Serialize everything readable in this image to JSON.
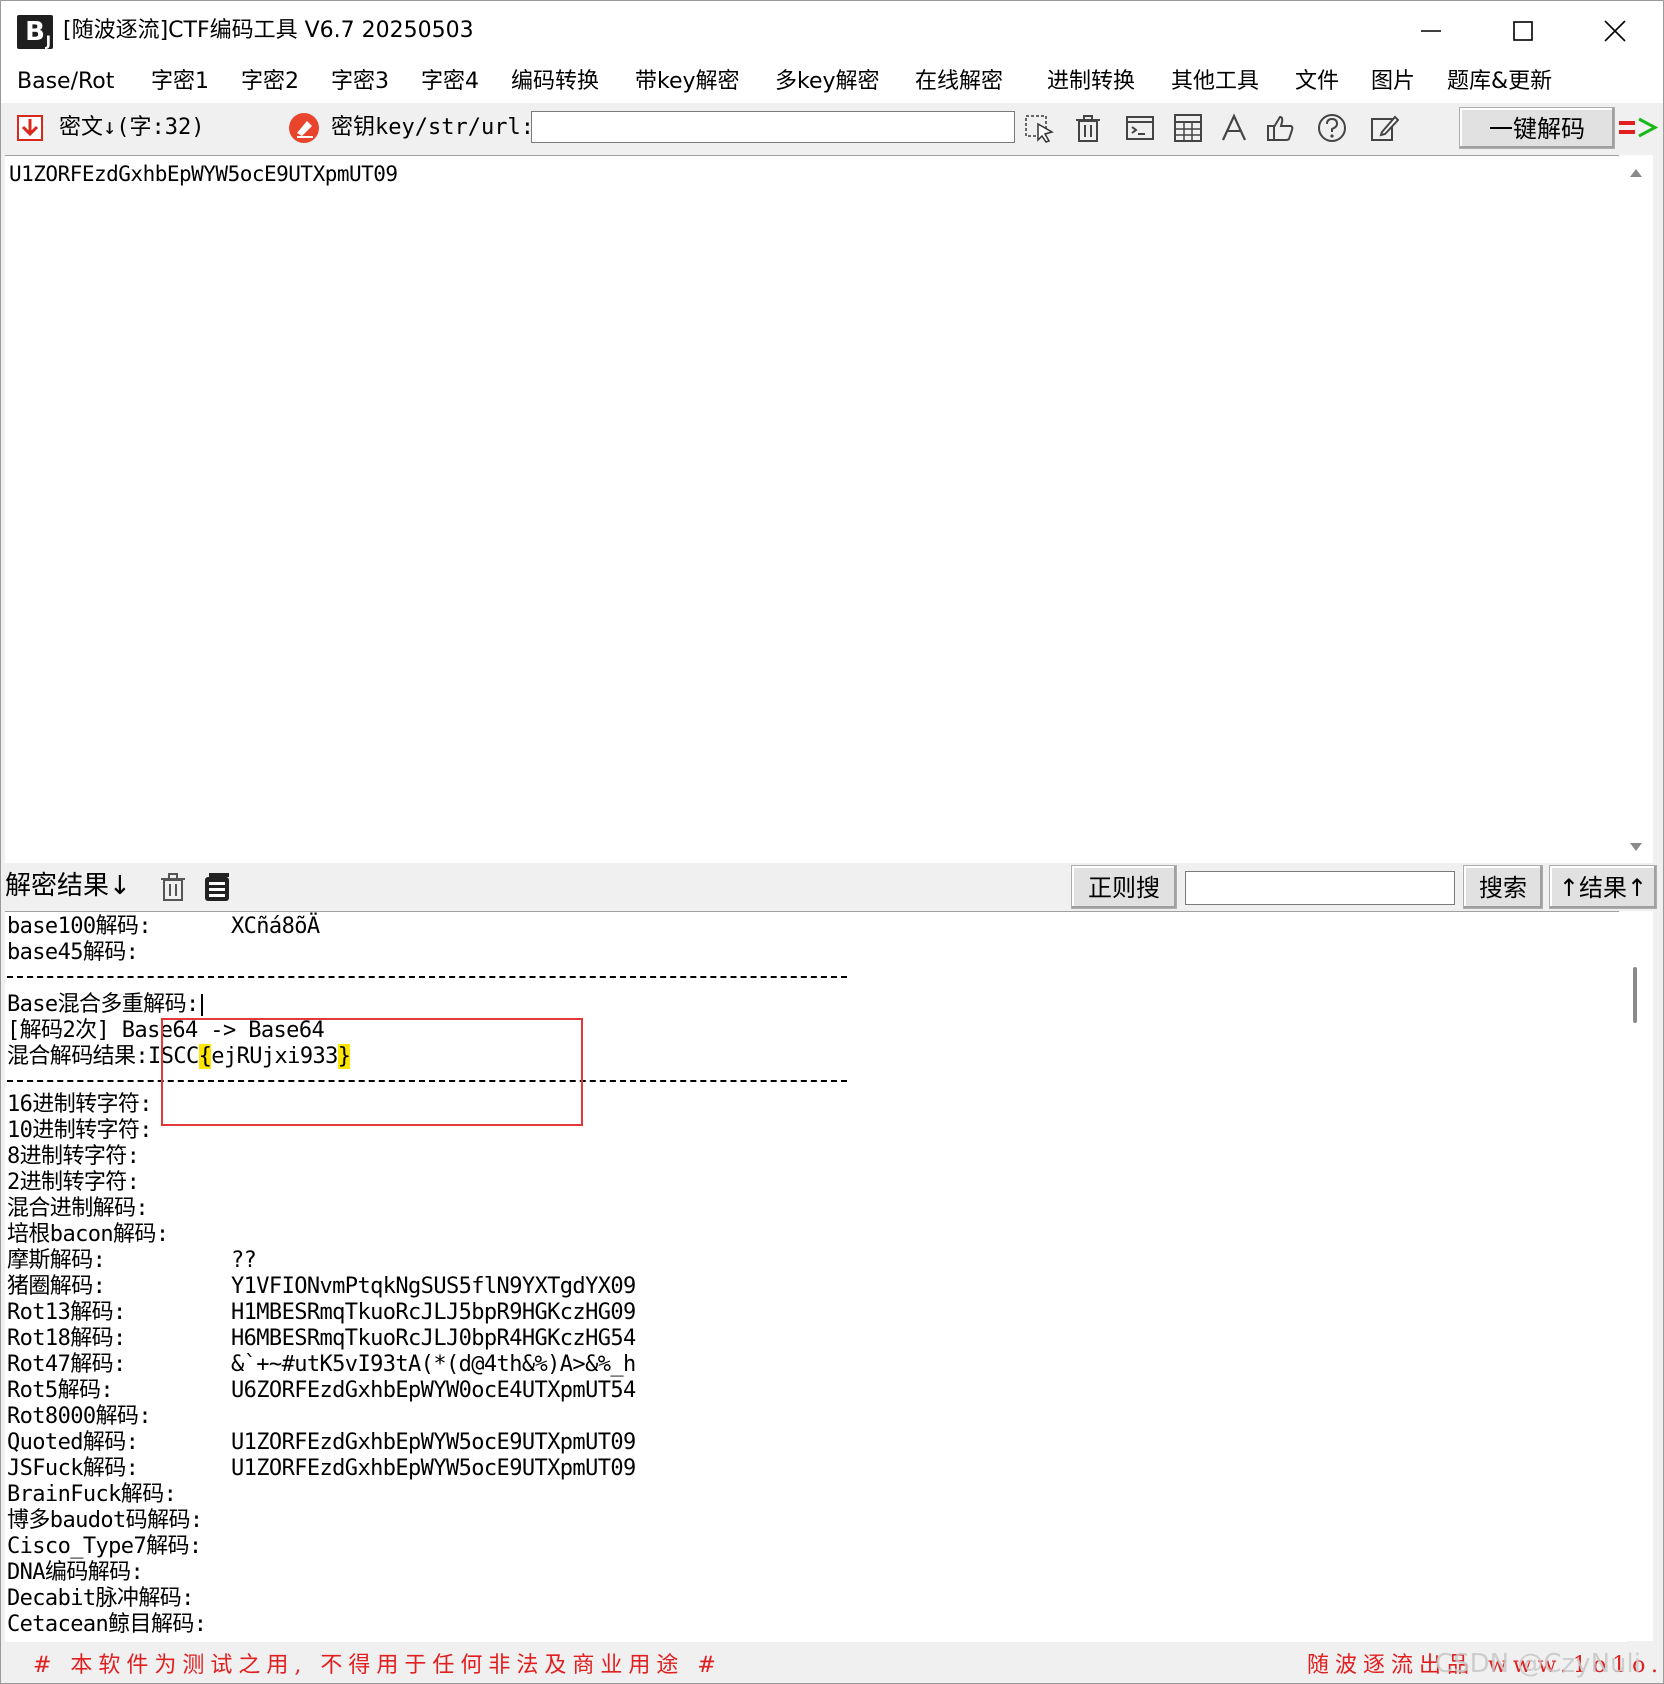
{
  "window": {
    "title": "[随波逐流]CTF编码工具 V6.7  20250503",
    "icon_text": "B"
  },
  "menu": [
    {
      "id": "base-rot",
      "label": "Base/Rot"
    },
    {
      "id": "zimi1",
      "label": "字密1"
    },
    {
      "id": "zimi2",
      "label": "字密2"
    },
    {
      "id": "zimi3",
      "label": "字密3"
    },
    {
      "id": "zimi4",
      "label": "字密4"
    },
    {
      "id": "encode-convert",
      "label": "编码转换"
    },
    {
      "id": "key-decrypt",
      "label": "带key解密"
    },
    {
      "id": "multikey-decrypt",
      "label": "多key解密"
    },
    {
      "id": "online-decrypt",
      "label": "在线解密"
    },
    {
      "id": "radix-convert",
      "label": "进制转换"
    },
    {
      "id": "other-tools",
      "label": "其他工具"
    },
    {
      "id": "file",
      "label": "文件"
    },
    {
      "id": "image",
      "label": "图片"
    },
    {
      "id": "library-update",
      "label": "题库&更新"
    }
  ],
  "toolbar": {
    "cipher_label": "密文↓(字:32)",
    "key_label": "密钥key/str/url:",
    "key_value": "",
    "decode_button": "一键解码",
    "arrow_symbol": "=>",
    "icons": [
      "cursor-select-icon",
      "trash-icon",
      "terminal-icon",
      "calculator-icon",
      "font-icon",
      "thumbs-up-icon",
      "help-icon",
      "edit-icon"
    ]
  },
  "cipher": {
    "text": "U1ZORFEzdGxhbEpWYW5ocE9UTXpmUT09"
  },
  "result_bar": {
    "label": "解密结果↓",
    "regex_button": "正则搜",
    "search_value": "",
    "search_button": "搜索",
    "result_button": "↑结果↑"
  },
  "results": {
    "base100": {
      "label": "base100解码:",
      "value": "XCñá8õÄ"
    },
    "base45": {
      "label": "base45解码:",
      "value": ""
    },
    "mixed_header": "Base混合多重解码:",
    "mixed_steps": "[解码2次] Base64 -> Base64",
    "mixed_result_label": "混合解码结果:",
    "mixed_result_prefix": "ISCC",
    "mixed_result_open": "{",
    "mixed_result_body": "ejRUjxi933",
    "mixed_result_close": "}",
    "rows": [
      {
        "label": "16进制转字符:",
        "value": ""
      },
      {
        "label": "10进制转字符:",
        "value": ""
      },
      {
        "label": "8进制转字符:",
        "value": ""
      },
      {
        "label": "2进制转字符:",
        "value": ""
      },
      {
        "label": "混合进制解码:",
        "value": ""
      },
      {
        "label": "培根bacon解码:",
        "value": ""
      },
      {
        "label": "摩斯解码:",
        "value": "??"
      },
      {
        "label": "猪圈解码:",
        "value": "Y1VFIONvmPtqkNgSUS5flN9YXTgdYX09"
      },
      {
        "label": "Rot13解码:",
        "value": "H1MBESRmqTkuoRcJLJ5bpR9HGKczHG09"
      },
      {
        "label": "Rot18解码:",
        "value": "H6MBESRmqTkuoRcJLJ0bpR4HGKczHG54"
      },
      {
        "label": "Rot47解码:",
        "value": "&`+~#utK5vI93tA(*(d@4th&%)A>&%_h"
      },
      {
        "label": "Rot5解码:",
        "value": "U6ZORFEzdGxhbEpWYW0ocE4UTXpmUT54"
      },
      {
        "label": "Rot8000解码:",
        "value": ""
      },
      {
        "label": "Quoted解码:",
        "value": "U1ZORFEzdGxhbEpWYW5ocE9UTXpmUT09"
      },
      {
        "label": "JSFuck解码:",
        "value": "U1ZORFEzdGxhbEpWYW5ocE9UTXpmUT09"
      },
      {
        "label": "BrainFuck解码:",
        "value": ""
      },
      {
        "label": "博多baudot码解码:",
        "value": ""
      },
      {
        "label": "Cisco_Type7解码:",
        "value": ""
      },
      {
        "label": "DNA编码解码:",
        "value": ""
      },
      {
        "label": "Decabit脉冲解码:",
        "value": ""
      },
      {
        "label": "Cetacean鲸目解码:",
        "value": ""
      }
    ]
  },
  "status": {
    "left": "# 本软件为测试之用, 不得用于任何非法及商业用途 #",
    "right": "随波逐流出品 www.1o1o.xyz",
    "watermark": "CSDN @CzyNuli"
  },
  "colors": {
    "highlight": "#ffe600",
    "annotation_box": "#e23a3a",
    "status_text": "#e02020"
  }
}
